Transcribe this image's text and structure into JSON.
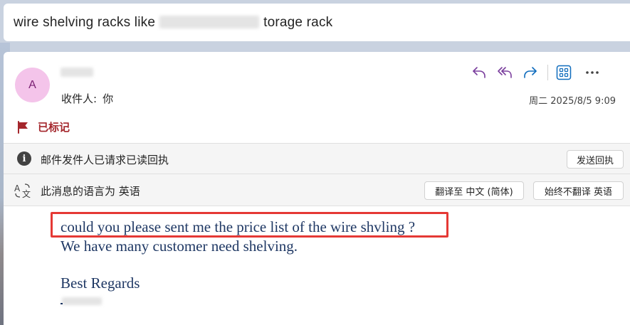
{
  "subject": {
    "text_start": "wire shelving racks like",
    "text_end": "torage rack"
  },
  "header": {
    "avatar_initial": "A",
    "recipient_label": "收件人:",
    "recipient_value": "你",
    "datetime": "周二 2025/8/5 9:09"
  },
  "icons": {
    "reply": "reply-icon",
    "reply_all": "reply-all-icon",
    "forward": "forward-icon",
    "apps": "apps-grid-icon",
    "more": "more-horizontal-icon",
    "flag": "flag-icon",
    "info": "info-icon",
    "translate": "translate-icon"
  },
  "flag": {
    "label": "已标记"
  },
  "read_receipt": {
    "info_text": "邮件发件人已请求已读回执",
    "button_label": "发送回执"
  },
  "language": {
    "info_text": "此消息的语言为 英语",
    "translate_button": "翻译至 中文 (简体)",
    "never_translate_button": "始终不翻译 英语"
  },
  "body": {
    "line1": "could you please sent me the price list of the wire shvling ?",
    "line2": "We have many customer need shelving.",
    "line3": "Best Regards"
  },
  "colors": {
    "accent_purple": "#7a3e9d",
    "accent_blue": "#0f6cbd",
    "flag_red": "#a4262c",
    "highlight_red": "#e53935",
    "body_text": "#1f3864",
    "avatar_bg": "#f4c4ea"
  }
}
